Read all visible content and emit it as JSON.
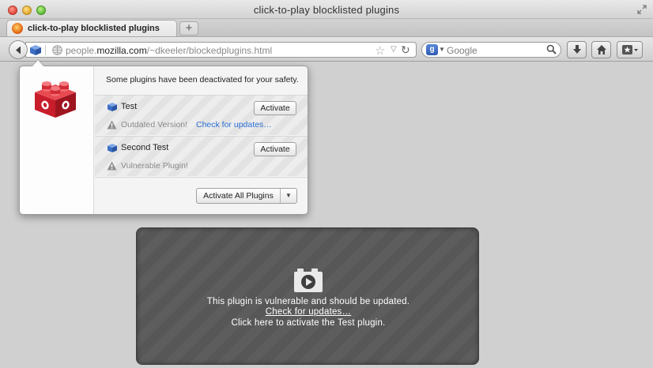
{
  "window": {
    "title": "click-to-play blocklisted plugins"
  },
  "tab": {
    "label": "click-to-play blocklisted plugins",
    "new_tab_symbol": "+"
  },
  "navbar": {
    "url_prefix": "people.",
    "url_host": "mozilla.com",
    "url_path": "/~dkeeler/blockedplugins.html",
    "search_placeholder": "Google",
    "search_engine_letter": "g"
  },
  "panel": {
    "message": "Some plugins have been deactivated for your safety.",
    "plugins": [
      {
        "name": "Test",
        "status": "Outdated Version!",
        "link": "Check for updates…",
        "action": "Activate"
      },
      {
        "name": "Second Test",
        "status": "Vulnerable Plugin!",
        "link": "",
        "action": "Activate"
      }
    ],
    "activate_all_label": "Activate All Plugins"
  },
  "placeholder": {
    "line1": "This plugin is vulnerable and should be updated.",
    "line2": "Check for updates…",
    "line3": "Click here to activate the Test plugin."
  },
  "colors": {
    "link": "#2a6fd4",
    "plugin_box": "#5a5a5a",
    "lego_red": "#d9232f"
  }
}
